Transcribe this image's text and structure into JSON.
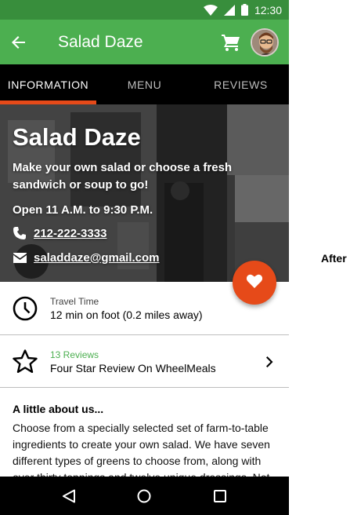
{
  "status_bar": {
    "time": "12:30"
  },
  "app_bar": {
    "title": "Salad Daze"
  },
  "tabs": [
    {
      "label": "INFORMATION",
      "active": true
    },
    {
      "label": "MENU",
      "active": false
    },
    {
      "label": "REVIEWS",
      "active": false
    }
  ],
  "hero": {
    "name": "Salad Daze",
    "description": "Make your own salad or choose a fresh sandwich or soup to go!",
    "hours": "Open 11 A.M. to 9:30 P.M.",
    "phone": "212-222-3333",
    "email": "saladdaze@gmail.com"
  },
  "travel": {
    "label": "Travel Time",
    "value": "12 min on foot (0.2 miles away)"
  },
  "reviews": {
    "count_label": "13 Reviews",
    "summary": "Four Star Review On WheelMeals"
  },
  "about": {
    "heading": "A little about us...",
    "body": "Choose from a specially selected set of farm-to-table ingredients to create your own salad. We have seven different types of greens to choose from, along with over thirty toppings and twelve unique dressings. Not"
  },
  "side_label": "After",
  "colors": {
    "primary": "#4caf50",
    "primary_dark": "#388e3c",
    "accent": "#e64a19"
  },
  "icons": [
    "wifi-icon",
    "signal-icon",
    "battery-icon",
    "back-arrow-icon",
    "cart-icon",
    "phone-icon",
    "mail-icon",
    "heart-icon",
    "clock-icon",
    "star-icon",
    "chevron-right-icon",
    "nav-back-icon",
    "nav-home-icon",
    "nav-recents-icon"
  ]
}
